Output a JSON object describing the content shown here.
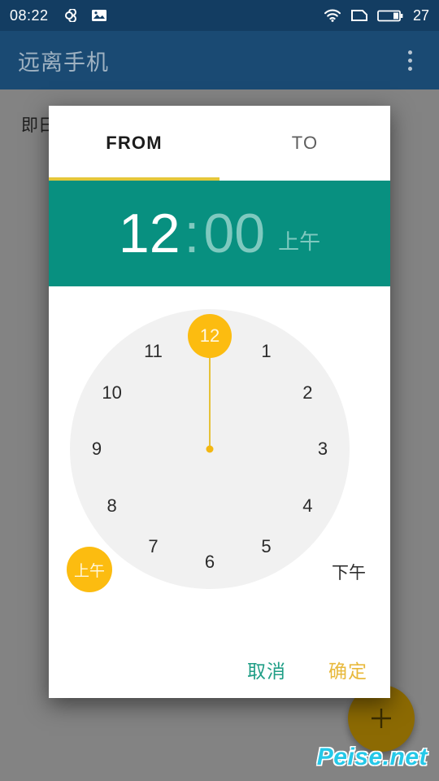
{
  "status_bar": {
    "clock": "08:22",
    "battery_level": "27",
    "icons": [
      "infinity-icon",
      "image-icon",
      "wifi-icon",
      "sim-card-icon",
      "battery-icon"
    ]
  },
  "app_bar": {
    "title": "远离手机",
    "overflow_icon": "overflow-menu-icon"
  },
  "background": {
    "content_line": "即日起生效",
    "fab_icon": "plus-icon"
  },
  "watermark": {
    "text": "Peise.net"
  },
  "dialog": {
    "tabs": [
      {
        "label": "FROM",
        "active": true
      },
      {
        "label": "TO",
        "active": false
      }
    ],
    "time_header": {
      "hours": "12",
      "separator": ":",
      "minutes": "00",
      "meridiem": "上午"
    },
    "clock": {
      "mode": "hours",
      "selected_value": "12",
      "numbers": [
        "12",
        "1",
        "2",
        "3",
        "4",
        "5",
        "6",
        "7",
        "8",
        "9",
        "10",
        "11"
      ]
    },
    "meridiem_buttons": {
      "am": {
        "label": "上午",
        "selected": true
      },
      "pm": {
        "label": "下午",
        "selected": false
      }
    },
    "actions": {
      "cancel": "取消",
      "ok": "确定"
    }
  },
  "colors": {
    "status_bar": "#133d62",
    "app_bar": "#1a4a73",
    "header_teal": "#089080",
    "accent_amber": "#fcbc10",
    "tab_indicator": "#e4c73a",
    "cancel_text": "#1f9e86",
    "ok_text": "#e8b93c",
    "watermark": "#25c8e8"
  }
}
